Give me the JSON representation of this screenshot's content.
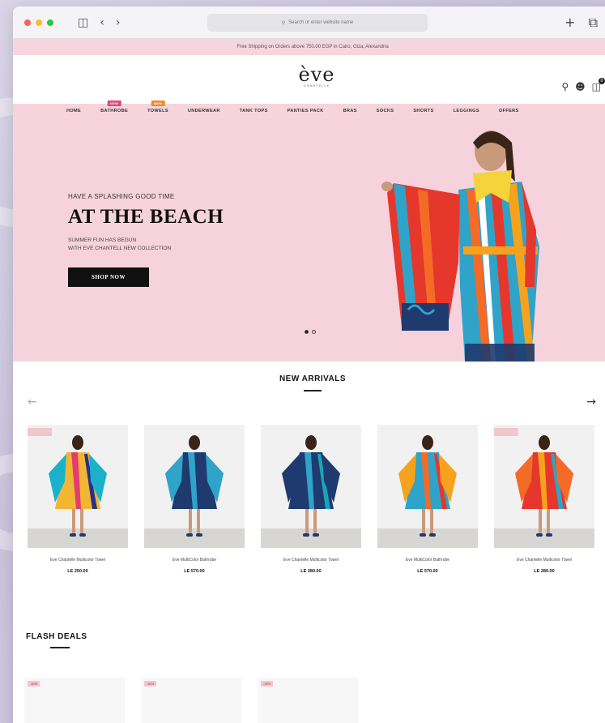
{
  "browser": {
    "address_placeholder": "Search or enter website name",
    "traffic_colors": [
      "#ff5f57",
      "#febc2e",
      "#28c840"
    ]
  },
  "promo": {
    "text": "Free Shipping on Orders above 750.00 EGP in Cairo, Giza, Alexandria"
  },
  "brand": {
    "logo_main": "ève",
    "logo_sub": "CHANTELLE"
  },
  "header": {
    "cart_count": "0"
  },
  "nav": {
    "items": [
      {
        "label": "HOME",
        "tag": ""
      },
      {
        "label": "BATHROBE",
        "tag": "NEW",
        "tag_color": "#e0457b"
      },
      {
        "label": "TOWELS",
        "tag": "NEW",
        "tag_color": "#f08a24"
      },
      {
        "label": "UNDERWEAR",
        "tag": ""
      },
      {
        "label": "TANK TOPS",
        "tag": ""
      },
      {
        "label": "PANTIES PACK",
        "tag": ""
      },
      {
        "label": "BRAS",
        "tag": ""
      },
      {
        "label": "SOCKS",
        "tag": ""
      },
      {
        "label": "SHORTS",
        "tag": ""
      },
      {
        "label": "LEGGINGS",
        "tag": ""
      },
      {
        "label": "OFFERS",
        "tag": ""
      }
    ]
  },
  "hero": {
    "kicker": "HAVE A SPLASHING GOOD TIME",
    "title": "AT THE BEACH",
    "sub_line1": "SUMMER FUN HAS BEGUN",
    "sub_line2": "WITH EVE CHANTELL NEW COLLECTION",
    "cta": "SHOP NOW",
    "background": "#f6d2dc"
  },
  "new_arrivals": {
    "title": "NEW ARRIVALS",
    "products": [
      {
        "name": "Eve Chantelle Multicolor Towel",
        "price": "LE 250.00",
        "sale_badge": true
      },
      {
        "name": "Eve MultiColor Bathrobe",
        "price": "LE 570.00",
        "sale_badge": false
      },
      {
        "name": "Eve Chantelle Multicolor Towel",
        "price": "LE 280.00",
        "sale_badge": false
      },
      {
        "name": "Eve MultiColor Bathrobe",
        "price": "LE 570.00",
        "sale_badge": false
      },
      {
        "name": "Eve Chantelle Multicolor Towel",
        "price": "LE 280.00",
        "sale_badge": true
      }
    ]
  },
  "flash_deals": {
    "title": "FLASH DEALS",
    "tags": [
      "-30%",
      "-30%",
      "-30%"
    ]
  }
}
